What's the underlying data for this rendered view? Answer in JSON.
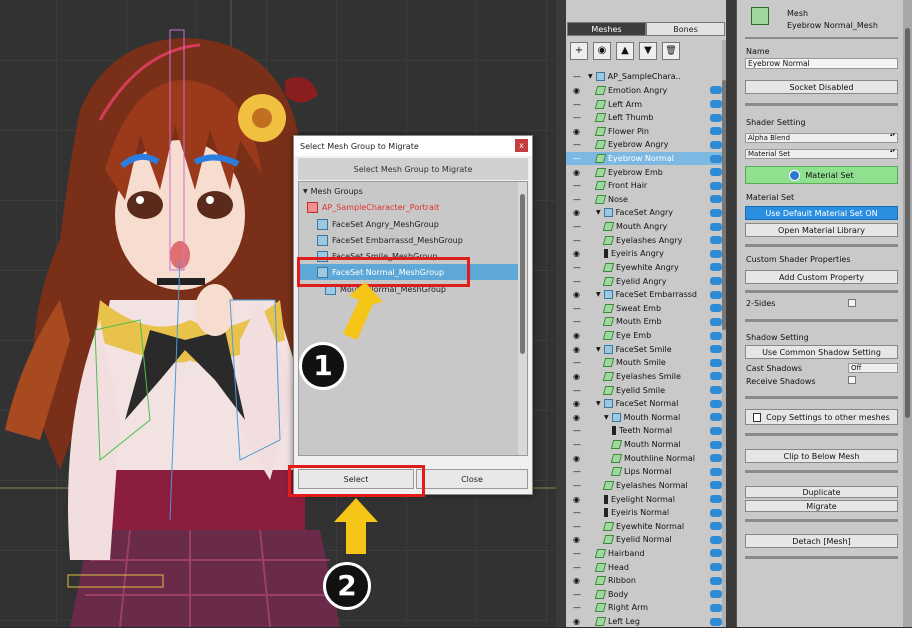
{
  "dialog": {
    "title": "Select Mesh Group to Migrate",
    "close_glyph": "x",
    "subtitle": "Select Mesh Group to Migrate",
    "tree_root": "Mesh Groups",
    "items": [
      {
        "label": "AP_SampleCharacter_Portrait",
        "color": "#e03030"
      },
      {
        "label": "FaceSet Angry_MeshGroup"
      },
      {
        "label": "FaceSet Embarrassd_MeshGroup"
      },
      {
        "label": "FaceSet Smile_MeshGroup"
      },
      {
        "label": "FaceSet Normal_MeshGroup",
        "selected": true
      },
      {
        "label": "Mouth Normal_MeshGroup"
      }
    ],
    "select_label": "Select",
    "close_label": "Close"
  },
  "annotations": {
    "step1": "1",
    "step2": "2",
    "highlight_color": "#e21b1b",
    "arrow_color": "#f5c518"
  },
  "outliner": {
    "tab_meshes": "Meshes",
    "tab_bones": "Bones",
    "toolbar": [
      "+",
      "◉",
      "▲",
      "▼",
      "🗑"
    ],
    "rows": [
      {
        "label": "AP_SampleChara..",
        "type": "root",
        "indent": 0
      },
      {
        "label": "Emotion Angry",
        "type": "mesh",
        "indent": 1
      },
      {
        "label": "Left Arm",
        "type": "mesh",
        "indent": 1
      },
      {
        "label": "Left Thumb",
        "type": "mesh",
        "indent": 1
      },
      {
        "label": "Flower Pin",
        "type": "mesh",
        "indent": 1
      },
      {
        "label": "Eyebrow Angry",
        "type": "mesh",
        "indent": 1
      },
      {
        "label": "Eyebrow Normal",
        "type": "mesh",
        "indent": 1,
        "selected": true
      },
      {
        "label": "Eyebrow Emb",
        "type": "mesh",
        "indent": 1
      },
      {
        "label": "Front Hair",
        "type": "mesh",
        "indent": 1
      },
      {
        "label": "Nose",
        "type": "mesh",
        "indent": 1
      },
      {
        "label": "FaceSet Angry",
        "type": "group",
        "indent": 1
      },
      {
        "label": "Mouth Angry",
        "type": "mesh",
        "indent": 2
      },
      {
        "label": "Eyelashes Angry",
        "type": "mesh",
        "indent": 2
      },
      {
        "label": "Eyeiris Angry",
        "type": "bone",
        "indent": 2
      },
      {
        "label": "Eyewhite Angry",
        "type": "mesh",
        "indent": 2
      },
      {
        "label": "Eyelid Angry",
        "type": "mesh",
        "indent": 2
      },
      {
        "label": "FaceSet Embarrassd",
        "type": "group",
        "indent": 1
      },
      {
        "label": "Sweat Emb",
        "type": "mesh",
        "indent": 2
      },
      {
        "label": "Mouth Emb",
        "type": "mesh",
        "indent": 2
      },
      {
        "label": "Eye Emb",
        "type": "mesh",
        "indent": 2
      },
      {
        "label": "FaceSet Smile",
        "type": "group",
        "indent": 1
      },
      {
        "label": "Mouth Smile",
        "type": "mesh",
        "indent": 2
      },
      {
        "label": "Eyelashes Smile",
        "type": "mesh",
        "indent": 2
      },
      {
        "label": "Eyelid Smile",
        "type": "mesh",
        "indent": 2
      },
      {
        "label": "FaceSet Normal",
        "type": "group",
        "indent": 1
      },
      {
        "label": "Mouth Normal",
        "type": "group",
        "indent": 2
      },
      {
        "label": "Teeth Normal",
        "type": "bone",
        "indent": 3
      },
      {
        "label": "Mouth Normal",
        "type": "mesh",
        "indent": 3
      },
      {
        "label": "Mouthline Normal",
        "type": "mesh",
        "indent": 3
      },
      {
        "label": "Lips Normal",
        "type": "mesh",
        "indent": 3
      },
      {
        "label": "Eyelashes Normal",
        "type": "mesh",
        "indent": 2
      },
      {
        "label": "Eyelight Normal",
        "type": "bone",
        "indent": 2
      },
      {
        "label": "Eyeiris Normal",
        "type": "bone",
        "indent": 2
      },
      {
        "label": "Eyewhite Normal",
        "type": "mesh",
        "indent": 2
      },
      {
        "label": "Eyelid Normal",
        "type": "mesh",
        "indent": 2
      },
      {
        "label": "Hairband",
        "type": "mesh",
        "indent": 1
      },
      {
        "label": "Head",
        "type": "mesh",
        "indent": 1
      },
      {
        "label": "Ribbon",
        "type": "mesh",
        "indent": 1
      },
      {
        "label": "Body",
        "type": "mesh",
        "indent": 1
      },
      {
        "label": "Right Arm",
        "type": "mesh",
        "indent": 1
      },
      {
        "label": "Left Leg",
        "type": "mesh",
        "indent": 1
      }
    ]
  },
  "properties": {
    "header_type": "Mesh",
    "header_name": "Eyebrow Normal_Mesh",
    "name_label": "Name",
    "name_value": "Eyebrow Normal",
    "socket_btn": "Socket Disabled",
    "shader_setting": "Shader Setting",
    "shader_blend": "Alpha Blend",
    "shader_mode": "Material Set",
    "material_set_btn": "Material Set",
    "material_set_label": "Material Set",
    "use_default_btn": "Use Default Material Set ON",
    "open_library_btn": "Open Material Library",
    "custom_shader": "Custom Shader Properties",
    "add_custom_btn": "Add Custom Property",
    "two_sides": "2-Sides",
    "shadow_setting": "Shadow Setting",
    "common_shadow_btn": "Use Common Shadow Setting",
    "cast_shadows": "Cast Shadows",
    "cast_shadows_value": "Off",
    "receive_shadows": "Receive Shadows",
    "copy_settings_btn": "Copy Settings to other meshes",
    "clip_btn": "Clip to Below Mesh",
    "duplicate_btn": "Duplicate",
    "migrate_btn": "Migrate",
    "detach_btn": "Detach [Mesh]"
  }
}
